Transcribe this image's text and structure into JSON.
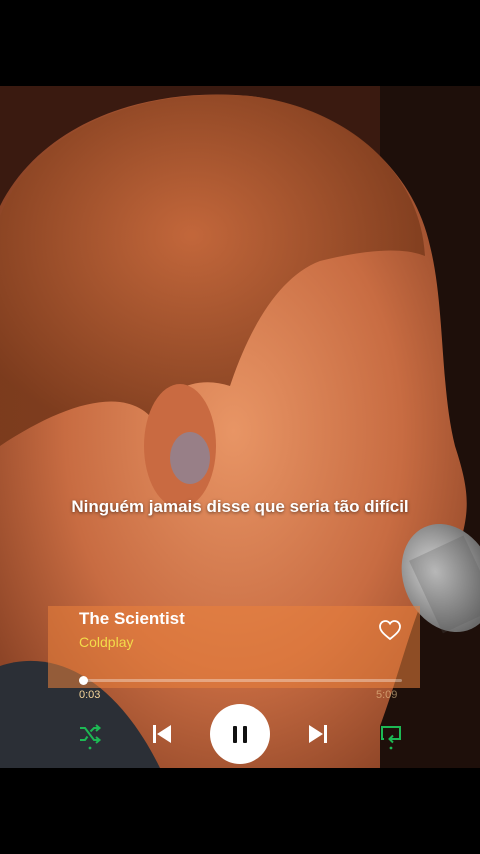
{
  "lyric": "Ninguém jamais disse que seria tão difícil",
  "player": {
    "title": "The Scientist",
    "artist": "Coldplay",
    "elapsed": "0:03",
    "duration": "5:09",
    "progress": 0.01,
    "liked": false,
    "is_playing": true,
    "shuffle": true,
    "repeat": true
  },
  "colors": {
    "accent_green": "#1db954",
    "artist_yellow": "#f3dc4a",
    "player_tint": "#eb823c"
  },
  "icons": {
    "heart": "heart-outline-icon",
    "shuffle": "shuffle-icon",
    "previous": "skip-previous-icon",
    "pause": "pause-icon",
    "next": "skip-next-icon",
    "repeat": "repeat-icon"
  }
}
